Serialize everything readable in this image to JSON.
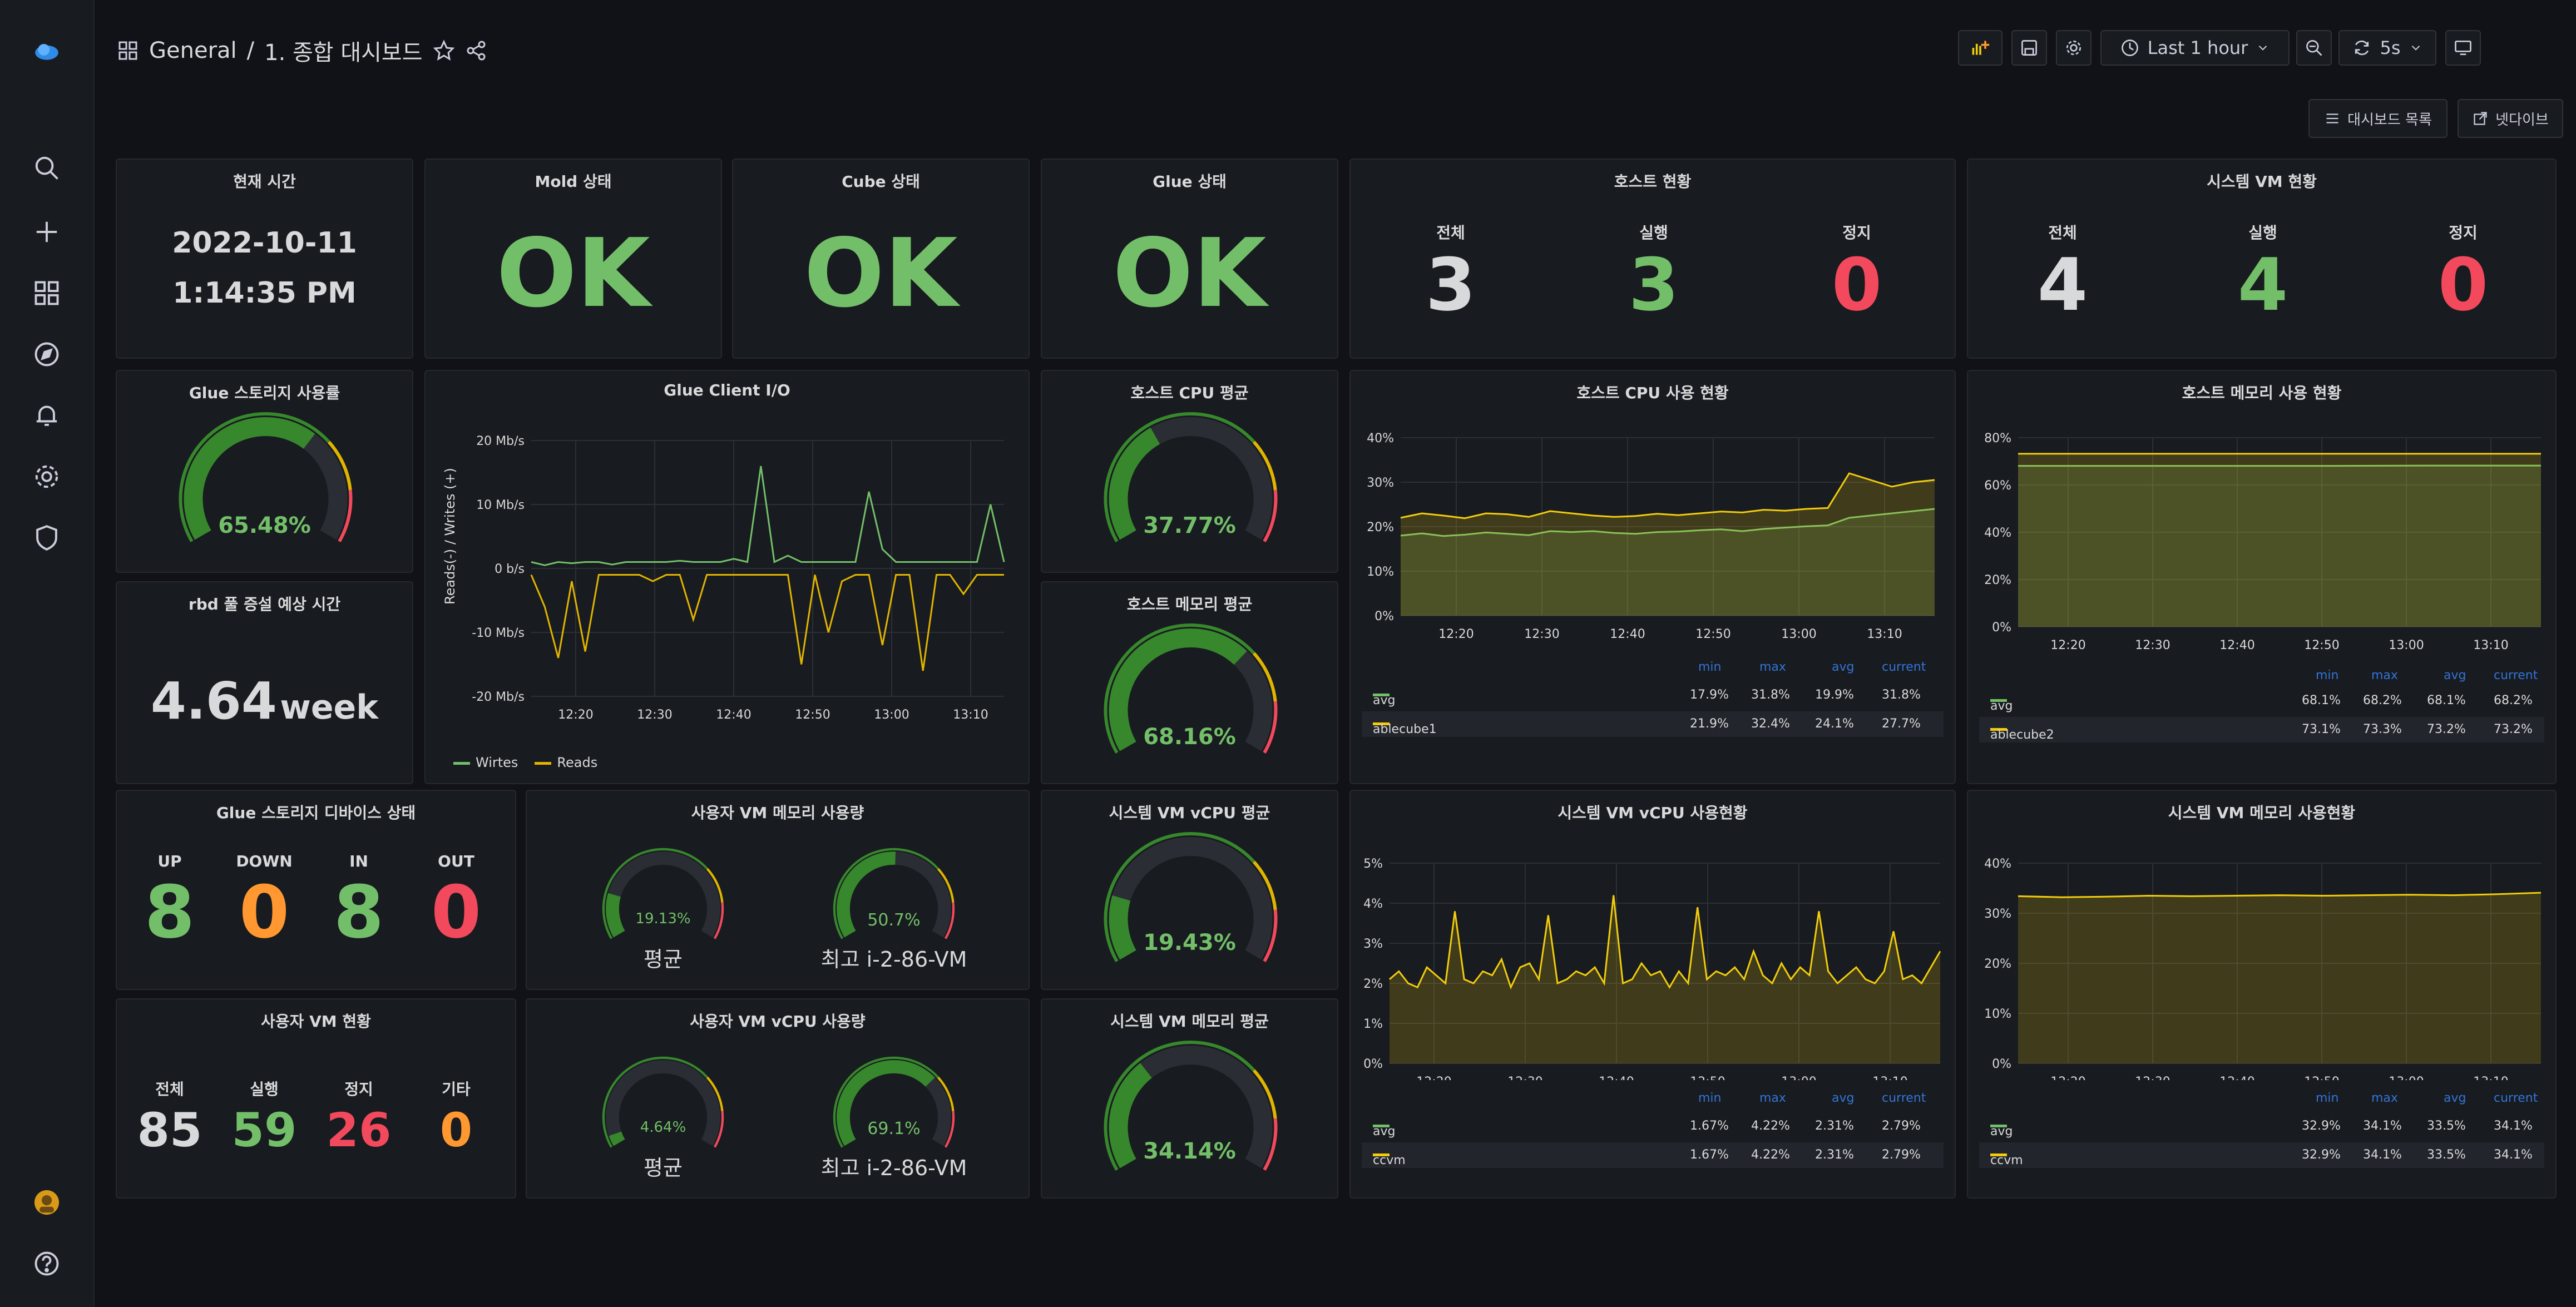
{
  "breadcrumb": {
    "folder": "General",
    "sep": "/",
    "dashboard": "1. 종합 대시보드"
  },
  "toolbar": {
    "time_range": "Last 1 hour",
    "refresh": "5s"
  },
  "subnav": {
    "list": "대시보드 목록",
    "next": "넷다이브"
  },
  "panels": {
    "current_time": {
      "title": "현재 시간",
      "date": "2022-10-11",
      "time": "1:14:35 PM"
    },
    "mold": {
      "title": "Mold 상태",
      "value": "OK"
    },
    "cube": {
      "title": "Cube 상태",
      "value": "OK"
    },
    "glue": {
      "title": "Glue 상태",
      "value": "OK"
    },
    "host_status": {
      "title": "호스트 현황",
      "labels": [
        "전체",
        "실행",
        "정지"
      ],
      "values": [
        "3",
        "3",
        "0"
      ]
    },
    "sys_vm_status": {
      "title": "시스템 VM 현황",
      "labels": [
        "전체",
        "실행",
        "정지"
      ],
      "values": [
        "4",
        "4",
        "0"
      ]
    },
    "glue_storage": {
      "title": "Glue 스토리지 사용률",
      "value": "65.48%",
      "fraction": 0.6548
    },
    "rbd": {
      "title": "rbd 풀 증설 예상 시간",
      "value": "4.64",
      "unit": "week"
    },
    "glue_io": {
      "title": "Glue Client I/O",
      "ylabel": "Reads(-) / Writes (+)",
      "legend": [
        "Wirtes",
        "Reads"
      ]
    },
    "host_cpu_avg": {
      "title": "호스트 CPU 평균",
      "value": "37.77%",
      "fraction": 0.3777
    },
    "host_mem_avg": {
      "title": "호스트 메모리 평균",
      "value": "68.16%",
      "fraction": 0.6816
    },
    "host_cpu_chart": {
      "title": "호스트 CPU 사용 현황",
      "headers": [
        "min",
        "max",
        "avg",
        "current"
      ],
      "rows": [
        {
          "name": "avg",
          "values": [
            "17.9%",
            "31.8%",
            "19.9%",
            "31.8%"
          ]
        },
        {
          "name": "ablecube1",
          "values": [
            "21.9%",
            "32.4%",
            "24.1%",
            "27.7%"
          ]
        }
      ]
    },
    "host_mem_chart": {
      "title": "호스트 메모리 사용 현황",
      "headers": [
        "min",
        "max",
        "avg",
        "current"
      ],
      "rows": [
        {
          "name": "avg",
          "values": [
            "68.1%",
            "68.2%",
            "68.1%",
            "68.2%"
          ]
        },
        {
          "name": "ablecube2",
          "values": [
            "73.1%",
            "73.3%",
            "73.2%",
            "73.2%"
          ]
        }
      ]
    },
    "glue_device": {
      "title": "Glue 스토리지 디바이스 상태",
      "labels": [
        "UP",
        "DOWN",
        "IN",
        "OUT"
      ],
      "values": [
        "8",
        "0",
        "8",
        "0"
      ]
    },
    "user_vm_mem": {
      "title": "사용자 VM 메모리 사용량",
      "g1": {
        "value": "19.13%",
        "label": "평균",
        "fraction": 0.1913
      },
      "g2": {
        "value": "50.7%",
        "label": "최고 i-2-86-VM",
        "fraction": 0.507
      }
    },
    "sys_vm_vcpu_avg": {
      "title": "시스템 VM vCPU 평균",
      "value": "19.43%",
      "fraction": 0.1943
    },
    "sys_vm_vcpu_chart": {
      "title": "시스템 VM vCPU 사용현황",
      "headers": [
        "min",
        "max",
        "avg",
        "current"
      ],
      "rows": [
        {
          "name": "avg",
          "values": [
            "1.67%",
            "4.22%",
            "2.31%",
            "2.79%"
          ]
        },
        {
          "name": "ccvm",
          "values": [
            "1.67%",
            "4.22%",
            "2.31%",
            "2.79%"
          ]
        }
      ]
    },
    "sys_vm_mem_chart": {
      "title": "시스템 VM 메모리 사용현황",
      "headers": [
        "min",
        "max",
        "avg",
        "current"
      ],
      "rows": [
        {
          "name": "avg",
          "values": [
            "32.9%",
            "34.1%",
            "33.5%",
            "34.1%"
          ]
        },
        {
          "name": "ccvm",
          "values": [
            "32.9%",
            "34.1%",
            "33.5%",
            "34.1%"
          ]
        }
      ]
    },
    "user_vm_status": {
      "title": "사용자 VM 현황",
      "labels": [
        "전체",
        "실행",
        "정지",
        "기타"
      ],
      "values": [
        "85",
        "59",
        "26",
        "0"
      ]
    },
    "user_vm_vcpu": {
      "title": "사용자 VM vCPU 사용량",
      "g1": {
        "value": "4.64%",
        "label": "평균",
        "fraction": 0.0464
      },
      "g2": {
        "value": "69.1%",
        "label": "최고 i-2-86-VM",
        "fraction": 0.691
      }
    },
    "sys_vm_mem_avg": {
      "title": "시스템 VM 메모리 평균",
      "value": "34.14%",
      "fraction": 0.3414
    }
  },
  "chart_data": [
    {
      "type": "line",
      "title": "Glue Client I/O",
      "ylabel": "Reads(-) / Writes (+)",
      "x_ticks": [
        "12:20",
        "12:30",
        "12:40",
        "12:50",
        "13:00",
        "13:10"
      ],
      "y_ticks": [
        "20 Mb/s",
        "10 Mb/s",
        "0 b/s",
        "-10 Mb/s",
        "-20 Mb/s"
      ],
      "ylim": [
        -20,
        20
      ],
      "series": [
        {
          "name": "Wirtes",
          "color": "#73bf69",
          "values": [
            1,
            0.5,
            1,
            0.8,
            1,
            1,
            0.6,
            1,
            1,
            1,
            1,
            1.2,
            1,
            1,
            1,
            1.5,
            1,
            16,
            1,
            2,
            1,
            1,
            1,
            1,
            1,
            12,
            3,
            1,
            1,
            1,
            1,
            1,
            1,
            1,
            10,
            1
          ]
        },
        {
          "name": "Reads",
          "color": "#e0b400",
          "values": [
            -1,
            -6,
            -14,
            -2,
            -13,
            -1,
            -1,
            -1,
            -1,
            -2,
            -1,
            -1,
            -8,
            -1,
            -1,
            -1,
            -1,
            -1,
            -1,
            -1,
            -15,
            -1,
            -10,
            -2,
            -1,
            -1,
            -12,
            -1,
            -1,
            -16,
            -1,
            -1,
            -4,
            -1,
            -1,
            -1
          ]
        }
      ]
    },
    {
      "type": "area",
      "title": "호스트 CPU 사용 현황",
      "x_ticks": [
        "12:20",
        "12:30",
        "12:40",
        "12:50",
        "13:00",
        "13:10"
      ],
      "y_ticks": [
        "40%",
        "30%",
        "20%",
        "10%",
        "0%"
      ],
      "ylim": [
        0,
        40
      ],
      "series": [
        {
          "name": "avg",
          "color": "#73bf69",
          "values": [
            18,
            18.5,
            17.9,
            18.2,
            18.7,
            18.4,
            18.1,
            19,
            18.8,
            19,
            18.6,
            18.4,
            18.8,
            18.9,
            19.2,
            19.4,
            19,
            19.5,
            19.8,
            20.1,
            20.3,
            22,
            22.5,
            23,
            23.5,
            24
          ]
        },
        {
          "name": "ablecube1",
          "color": "#f2cc0c",
          "values": [
            22,
            23,
            22.5,
            21.9,
            23,
            22.8,
            22.2,
            23.5,
            23,
            22.5,
            22.2,
            22.4,
            22.9,
            22.6,
            23,
            23.4,
            23.2,
            23.8,
            23.6,
            24,
            24.2,
            32,
            30.5,
            29,
            30,
            30.5
          ]
        }
      ]
    },
    {
      "type": "area",
      "title": "호스트 메모리 사용 현황",
      "x_ticks": [
        "12:20",
        "12:30",
        "12:40",
        "12:50",
        "13:00",
        "13:10"
      ],
      "y_ticks": [
        "80%",
        "60%",
        "40%",
        "20%",
        "0%"
      ],
      "ylim": [
        0,
        80
      ],
      "series": [
        {
          "name": "avg",
          "color": "#73bf69",
          "values": [
            68.1,
            68.1,
            68.1,
            68.1,
            68.2,
            68.2
          ]
        },
        {
          "name": "ablecube2",
          "color": "#f2cc0c",
          "values": [
            73.2,
            73.2,
            73.2,
            73.2,
            73.2,
            73.2
          ]
        }
      ]
    },
    {
      "type": "area",
      "title": "시스템 VM vCPU 사용현황",
      "x_ticks": [
        "12:20",
        "12:30",
        "12:40",
        "12:50",
        "13:00",
        "13:10"
      ],
      "y_ticks": [
        "5%",
        "4%",
        "3%",
        "2%",
        "1%",
        "0%"
      ],
      "ylim": [
        0,
        5
      ],
      "series": [
        {
          "name": "ccvm",
          "color": "#f2cc0c",
          "values": [
            2.1,
            2.3,
            2,
            1.9,
            2.4,
            2.2,
            2,
            3.8,
            2.1,
            2,
            2.3,
            2.2,
            2.6,
            1.9,
            2.4,
            2.5,
            2.1,
            3.7,
            2,
            2.1,
            2.3,
            2.2,
            2.4,
            2,
            4.2,
            2,
            2.1,
            2.5,
            2.2,
            2.3,
            1.9,
            2.3,
            2,
            3.9,
            2.1,
            2.3,
            2.2,
            2.4,
            2.1,
            2.8,
            2.2,
            2,
            2.5,
            2.1,
            2.4,
            2.2,
            3.8,
            2.3,
            2,
            2.2,
            2.4,
            2.1,
            2,
            2.3,
            3.3,
            2.1,
            2.2,
            2,
            2.4,
            2.8
          ]
        }
      ]
    },
    {
      "type": "area",
      "title": "시스템 VM 메모리 사용현황",
      "x_ticks": [
        "12:20",
        "12:30",
        "12:40",
        "12:50",
        "13:00",
        "13:10"
      ],
      "y_ticks": [
        "40%",
        "30%",
        "20%",
        "10%",
        "0%"
      ],
      "ylim": [
        0,
        40
      ],
      "series": [
        {
          "name": "ccvm",
          "color": "#f2cc0c",
          "values": [
            33.4,
            33.2,
            33.3,
            33.5,
            33.4,
            33.5,
            33.6,
            33.5,
            33.6,
            33.7,
            33.6,
            33.8,
            34.1
          ]
        }
      ]
    }
  ]
}
